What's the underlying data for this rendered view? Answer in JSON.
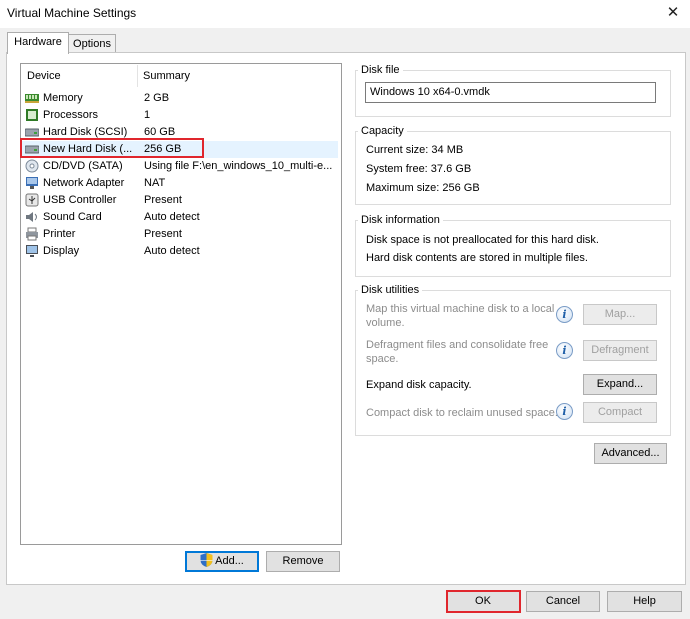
{
  "window": {
    "title": "Virtual Machine Settings",
    "close_glyph": "✕"
  },
  "tabs": [
    {
      "label": "Hardware",
      "active": true
    },
    {
      "label": "Options",
      "active": false
    }
  ],
  "device_list": {
    "headers": {
      "device": "Device",
      "summary": "Summary"
    },
    "rows": [
      {
        "icon": "memory-icon",
        "name": "Memory",
        "summary": "2 GB"
      },
      {
        "icon": "processor-icon",
        "name": "Processors",
        "summary": "1"
      },
      {
        "icon": "hard-disk-icon",
        "name": "Hard Disk (SCSI)",
        "summary": "60 GB"
      },
      {
        "icon": "hard-disk-icon",
        "name": "New Hard Disk (...",
        "summary": "256 GB",
        "selected": true
      },
      {
        "icon": "cd-dvd-icon",
        "name": "CD/DVD (SATA)",
        "summary": "Using file F:\\en_windows_10_multi-e..."
      },
      {
        "icon": "network-adapter-icon",
        "name": "Network Adapter",
        "summary": "NAT"
      },
      {
        "icon": "usb-icon",
        "name": "USB Controller",
        "summary": "Present"
      },
      {
        "icon": "sound-card-icon",
        "name": "Sound Card",
        "summary": "Auto detect"
      },
      {
        "icon": "printer-icon",
        "name": "Printer",
        "summary": "Present"
      },
      {
        "icon": "display-icon",
        "name": "Display",
        "summary": "Auto detect"
      }
    ]
  },
  "list_buttons": {
    "add": "Add...",
    "remove": "Remove"
  },
  "disk_file": {
    "label": "Disk file",
    "value": "Windows 10 x64-0.vmdk"
  },
  "capacity": {
    "label": "Capacity",
    "current_size": "Current size:  34 MB",
    "system_free": "System free:  37.6 GB",
    "maximum_size": "Maximum size:  256 GB"
  },
  "disk_information": {
    "label": "Disk information",
    "line1": "Disk space is not preallocated for this hard disk.",
    "line2": "Hard disk contents are stored in multiple files."
  },
  "disk_utilities": {
    "label": "Disk utilities",
    "map_text_1": "Map this virtual machine disk to a local",
    "map_text_2": "volume.",
    "map_button": "Map...",
    "defrag_text_1": "Defragment files and consolidate free",
    "defrag_text_2": "space.",
    "defrag_button": "Defragment",
    "expand_text": "Expand disk capacity.",
    "expand_button": "Expand...",
    "compact_text": "Compact disk to reclaim unused space.",
    "compact_button": "Compact",
    "info_glyph": "i"
  },
  "advanced_button": "Advanced...",
  "footer": {
    "ok": "OK",
    "cancel": "Cancel",
    "help": "Help"
  },
  "colors": {
    "highlight": "#e0262d",
    "selection": "#e5f3ff",
    "focus": "#0078d7"
  }
}
